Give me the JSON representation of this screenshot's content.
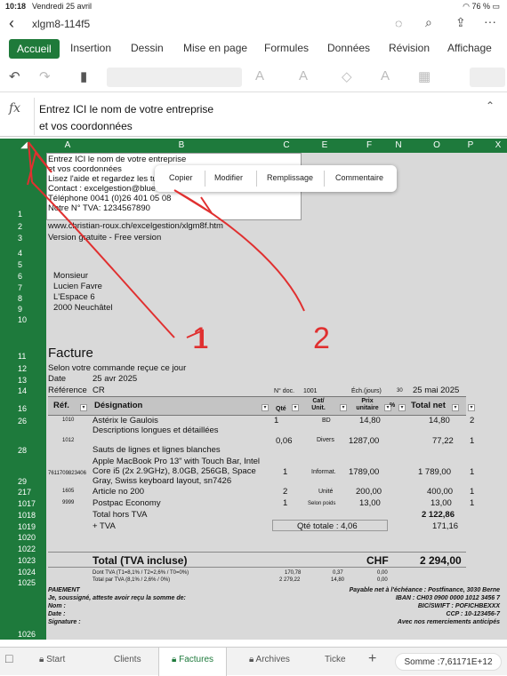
{
  "status": {
    "time": "10:18",
    "date": "Vendredi 25 avril",
    "battery": "76 %"
  },
  "title": {
    "filename": "xlgm8-114f5"
  },
  "ribbon": {
    "tabs": [
      "Accueil",
      "Insertion",
      "Dessin",
      "Mise en page",
      "Formules",
      "Données",
      "Révision",
      "Affichage"
    ]
  },
  "formula": {
    "label": "fx",
    "line1": "Entrez ICI le nom de votre entreprise",
    "line2": "et vos coordonnées"
  },
  "columns": [
    "A",
    "B",
    "C",
    "E",
    "F",
    "N",
    "O",
    "P",
    "X"
  ],
  "rows": [
    "1",
    "2",
    "3",
    "4",
    "5",
    "6",
    "7",
    "8",
    "9",
    "10",
    "11",
    "12",
    "13",
    "14",
    "16",
    "26",
    "28",
    "29",
    "217",
    "1017",
    "1018",
    "1019",
    "1020",
    "1022",
    "1023",
    "1024",
    "1025",
    "1026"
  ],
  "context_menu": {
    "items": [
      "Copier",
      "Modifier",
      "Remplissage",
      "Commentaire"
    ]
  },
  "header_block": {
    "l1": "Entrez ICI le nom de votre entreprise",
    "l2": "et vos coordonnées",
    "l3": "Lisez l'aide et regardez les tu",
    "l4": "Contact : excelgestion@bluewin.ch",
    "l5": "Téléphone 0041 (0)26 401 05 08",
    "l6": "Notre N° TVA: 1234567890"
  },
  "website": "www.christian-roux.ch/excelgestion/xlgm8f.htm",
  "version": "Version gratuite - Free version",
  "address": [
    "Monsieur",
    "Lucien Favre",
    "L'Espace 6",
    "2000 Neuchâtel"
  ],
  "invoice": {
    "title": "Facture",
    "subtitle": "Selon votre commande reçue ce jour",
    "date_label": "Date",
    "date_value": "25 avr 2025",
    "ref_label": "Référence",
    "ref_value": "CR",
    "doc_label": "N° doc.",
    "doc_value": "1001",
    "due_label": "Éch.(jours)",
    "due_days": "30",
    "due_date": "25 mai 2025"
  },
  "table_headers": {
    "ref": "Réf.",
    "designation": "Désignation",
    "qty": "Qté",
    "cat": "Cat/ Unit.",
    "price": "Prix unitaire",
    "pct": "%",
    "total": "Total net"
  },
  "items": [
    {
      "ref": "1010",
      "designation": "Astérix le Gaulois",
      "qty": "1",
      "cat": "BD",
      "price": "14,80",
      "total": "14,80",
      "p": "2"
    },
    {
      "ref": "1012",
      "designation": "Descriptions longues et détaillées\n\nSauts de lignes et lignes blanches",
      "qty": "0,06",
      "cat": "Divers",
      "price": "1287,00",
      "total": "77,22",
      "p": "1"
    },
    {
      "ref": "7611709823406",
      "designation": "Apple MacBook Pro 13\" with Touch Bar, Intel Core i5 (2x 2.9GHz), 8.0GB, 256GB, Space Gray, Swiss keyboard layout, sn7426",
      "qty": "1",
      "cat": "Informat.",
      "price": "1789,00",
      "total": "1 789,00",
      "p": "1"
    },
    {
      "ref": "1605",
      "designation": "Article no 200",
      "qty": "2",
      "cat": "Unité",
      "price": "200,00",
      "total": "400,00",
      "p": "1"
    },
    {
      "ref": "9999",
      "designation": "Postpac Economy",
      "qty": "1",
      "cat": "Selon poids",
      "price": "13,00",
      "total": "13,00",
      "p": "1"
    }
  ],
  "totals": {
    "hors_tva_label": "Total hors TVA",
    "hors_tva_value": "2 122,86",
    "tva_label": "+ TVA",
    "qty_total": "Qté totale : 4,06",
    "tva_value": "171,16",
    "total_label": "Total (TVA incluse)",
    "currency": "CHF",
    "total_value": "2 294,00"
  },
  "tva_detail": {
    "line1_label": "Dont TVA (T1=8,1% / T2=2,6% / T0=0%)",
    "line1_v1": "170,78",
    "line1_v2": "0,37",
    "line1_v3": "0,00",
    "line2_label": "Total par TVA (8,1% / 2,6% / 0%)",
    "line2_v1": "2 279,22",
    "line2_v2": "14,80",
    "line2_v3": "0,00"
  },
  "footer": {
    "paiement": "PAIEMENT",
    "atteste": "Je, soussigné, atteste avoir reçu la somme de:",
    "nom": "Nom :",
    "date": "Date :",
    "signature": "Signature :",
    "payable": "Payable net à l'échéance : Postfinance, 3030 Berne",
    "iban": "IBAN : CH03 0900 0000 1012 3456 7",
    "bic": "BIC/SWIFT : POFICHBEXXX",
    "ccp": "CCP : 10-123456-7",
    "merci": "Avec nos remerciements anticipés"
  },
  "sheet_tabs": [
    "Start",
    "Clients",
    "Factures",
    "Archives",
    "Ticke"
  ],
  "sum": "Somme :7,61171E+12",
  "annotations": {
    "n1": "1",
    "n2": "2"
  }
}
